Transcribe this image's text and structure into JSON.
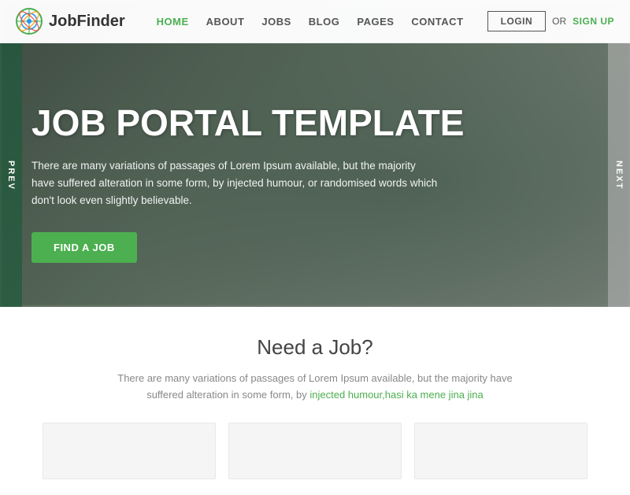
{
  "logo": {
    "text": "JobFinder"
  },
  "nav": {
    "links": [
      {
        "label": "HOME",
        "active": true
      },
      {
        "label": "ABOUT",
        "active": false
      },
      {
        "label": "JOBS",
        "active": false
      },
      {
        "label": "BLOG",
        "active": false
      },
      {
        "label": "PAGES",
        "active": false
      },
      {
        "label": "CONTACT",
        "active": false
      }
    ],
    "login_label": "LOGIN",
    "or_text": "OR",
    "signup_label": "SIGN UP"
  },
  "hero": {
    "title": "JOB PORTAL TEMPLATE",
    "description": "There are many variations of passages of Lorem Ipsum available, but the majority have suffered alteration in some form, by injected humour, or randomised words which don't look even slightly believable.",
    "cta_label": "FIND A JOB",
    "prev_label": "PREV",
    "next_label": "NEXT"
  },
  "section": {
    "title": "Need a Job?",
    "description_plain": "There are many variations of passages of Lorem Ipsum available, but the majority have suffered alteration in some form, by",
    "description_link": "injected humour,hasi ka mene jina jina",
    "colors": {
      "green": "#4CAF50",
      "link": "#4CAF50"
    }
  }
}
